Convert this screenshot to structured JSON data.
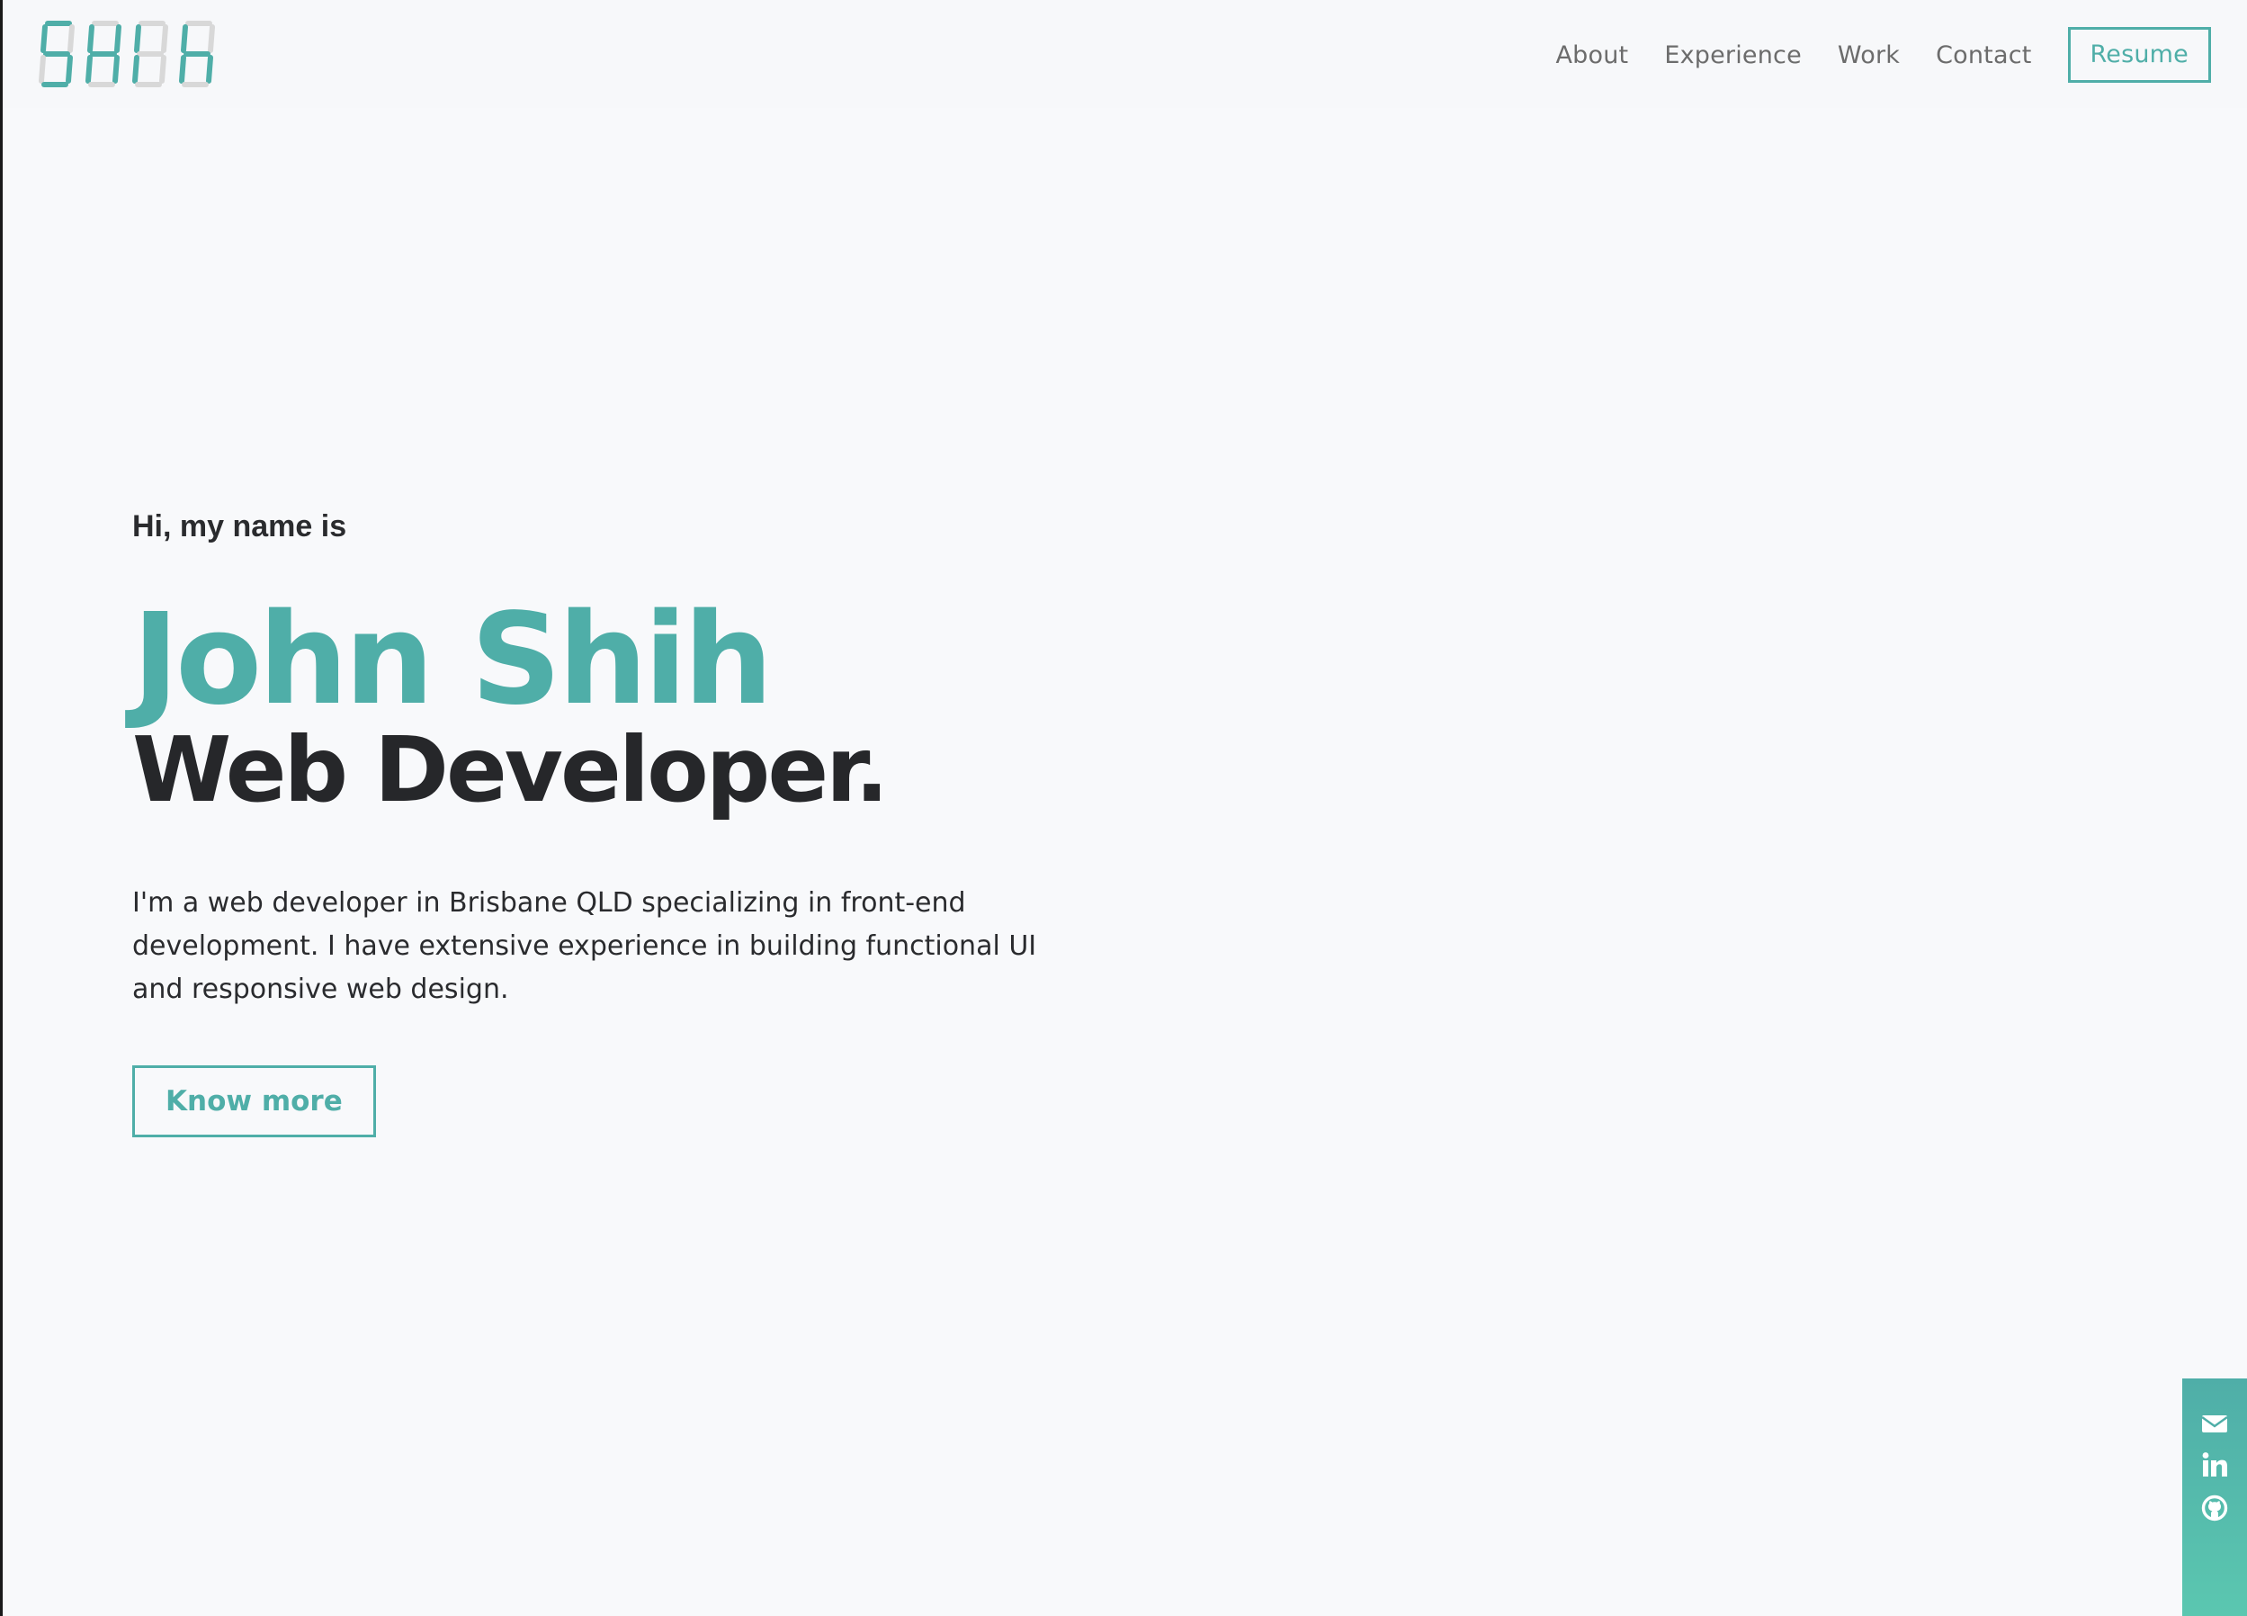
{
  "logo": {
    "text": "SHIH"
  },
  "nav": {
    "links": [
      "About",
      "Experience",
      "Work",
      "Contact"
    ],
    "resume_label": "Resume"
  },
  "hero": {
    "greeting": "Hi, my name is",
    "name": "John Shih",
    "role": "Web Developer.",
    "intro": "I'm a web developer in Brisbane QLD specializing in front-end development. I have extensive experience in building functional UI and responsive web design.",
    "cta_label": "Know more"
  },
  "social": {
    "icons": [
      "envelope-icon",
      "linkedin-icon",
      "github-icon"
    ]
  },
  "colors": {
    "accent": "#4faea8",
    "background": "#f8f9fb",
    "text_dark": "#26272a",
    "nav_text": "#6c6c6c"
  }
}
